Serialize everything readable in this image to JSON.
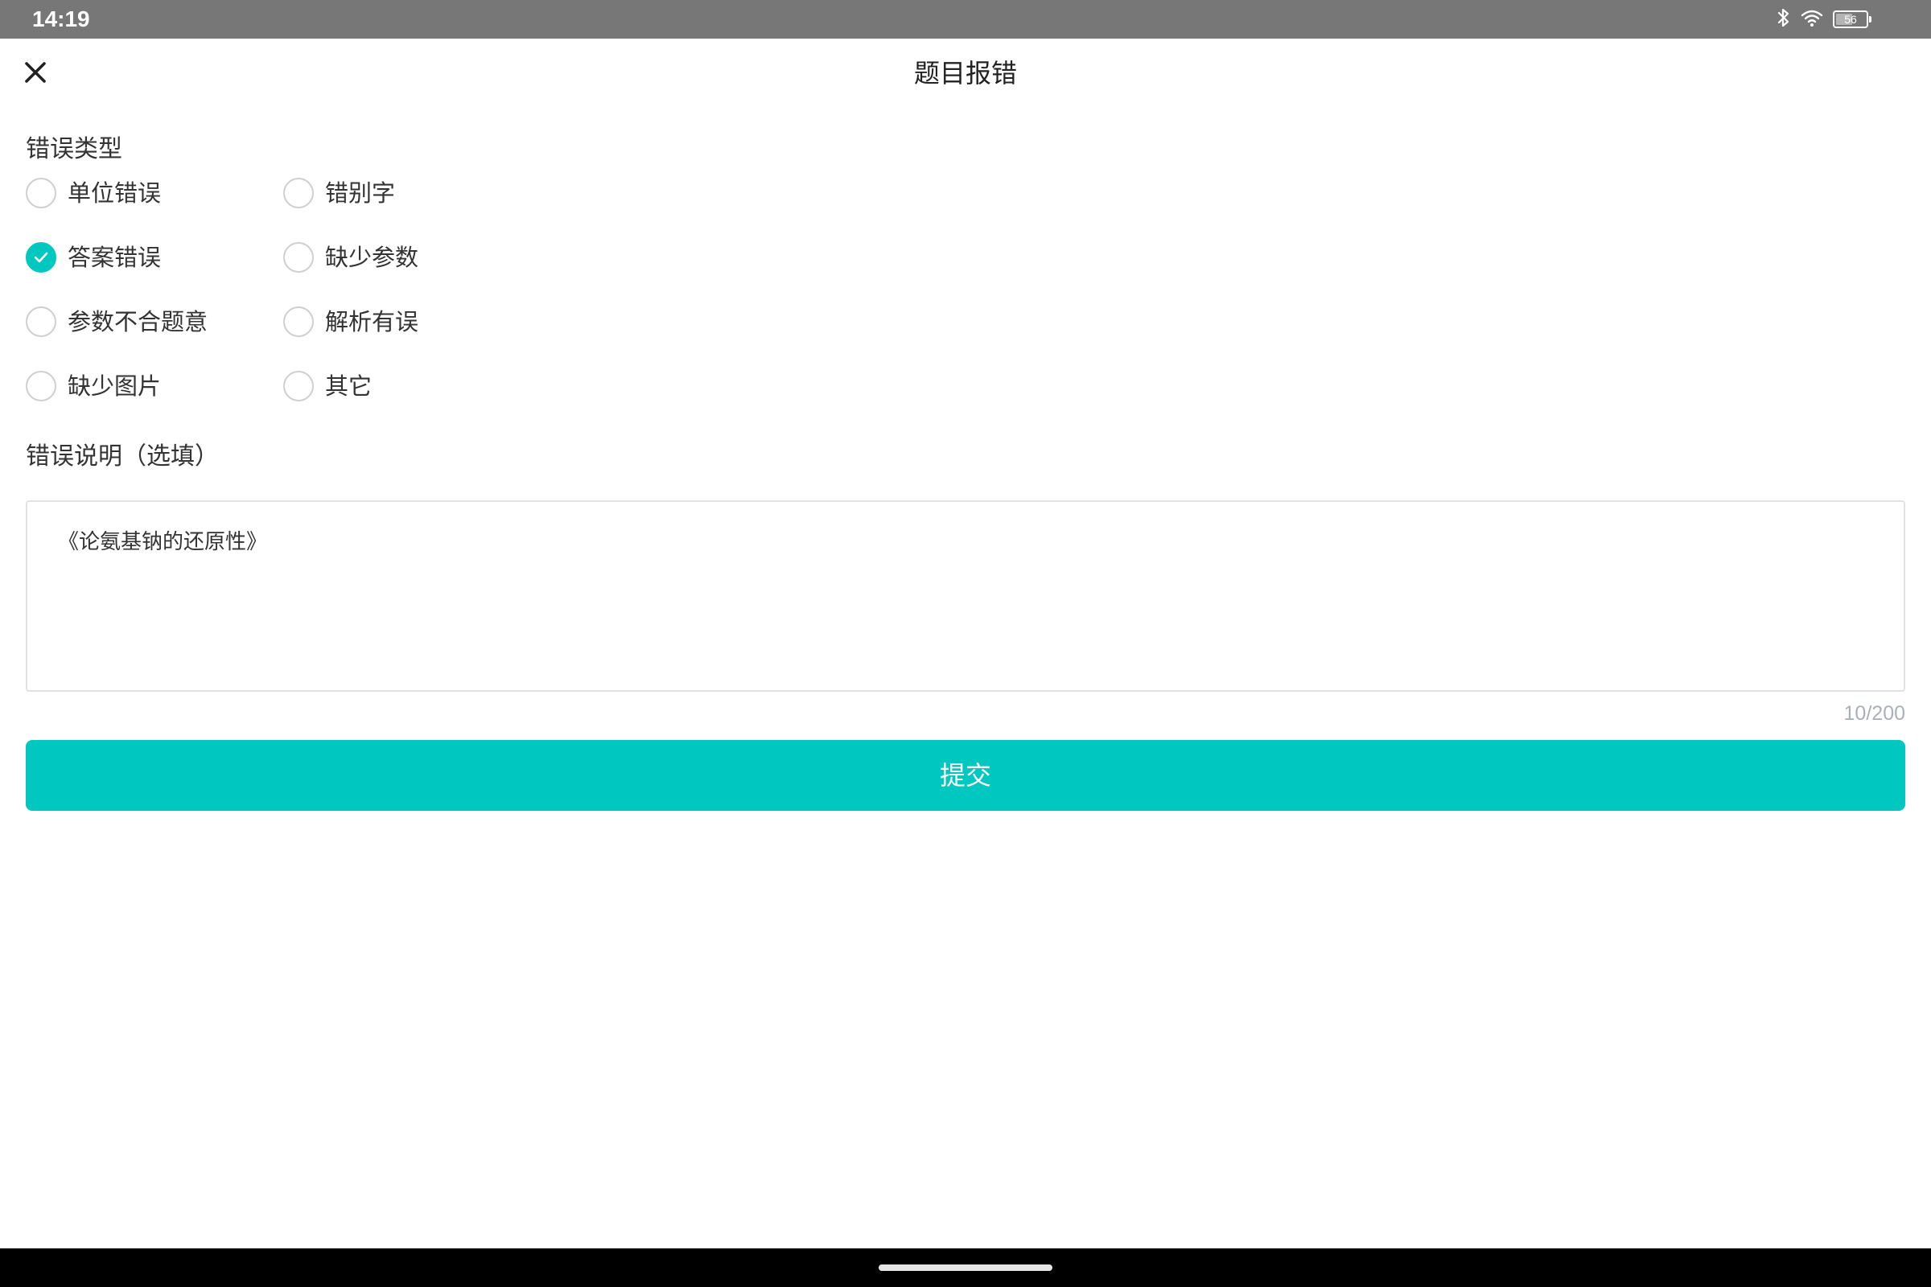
{
  "status_bar": {
    "time": "14:19",
    "battery_text": "56",
    "battery_level": 0.56,
    "icons": [
      "bluetooth-icon",
      "wifi-icon",
      "battery-icon"
    ]
  },
  "header": {
    "title": "题目报错",
    "close_icon": "close-icon"
  },
  "error_type": {
    "label": "错误类型",
    "options": [
      {
        "label": "单位错误",
        "checked": false
      },
      {
        "label": "错别字",
        "checked": false
      },
      {
        "label": "答案错误",
        "checked": true
      },
      {
        "label": "缺少参数",
        "checked": false
      },
      {
        "label": "参数不合题意",
        "checked": false
      },
      {
        "label": "解析有误",
        "checked": false
      },
      {
        "label": "缺少图片",
        "checked": false
      },
      {
        "label": "其它",
        "checked": false
      }
    ]
  },
  "description": {
    "label": "错误说明（选填）",
    "value": "《论氨基钠的还原性》",
    "counter": "10/200"
  },
  "submit": {
    "label": "提交"
  },
  "colors": {
    "accent": "#00c7c0",
    "status_bar": "#777777",
    "nav_bar": "#000000"
  }
}
